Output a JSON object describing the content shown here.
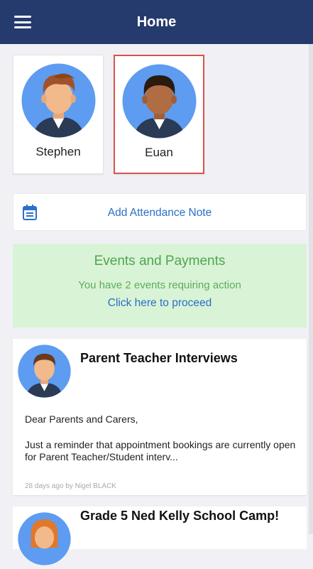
{
  "header": {
    "title": "Home",
    "menu_icon": "hamburger-menu-icon"
  },
  "students": [
    {
      "name": "Stephen",
      "selected": false
    },
    {
      "name": "Euan",
      "selected": true
    }
  ],
  "attendance": {
    "label": "Add Attendance Note",
    "icon": "calendar-icon"
  },
  "events": {
    "heading": "Events and Payments",
    "status": "You have 2 events requiring action",
    "link": "Click here to proceed"
  },
  "news": [
    {
      "title": "Parent Teacher Interviews",
      "greeting": "Dear Parents and Carers,",
      "body": "Just a reminder that appointment bookings are currently open for Parent Teacher/Student interv...",
      "meta": "28 days ago by Nigel BLACK"
    },
    {
      "title": "Grade 5 Ned Kelly School Camp!"
    }
  ],
  "colors": {
    "header_bg": "#253b6e",
    "selected_border": "#d9534f",
    "link": "#2a6fc8",
    "events_bg": "#d9f3d6",
    "events_text": "#4ea64e"
  }
}
